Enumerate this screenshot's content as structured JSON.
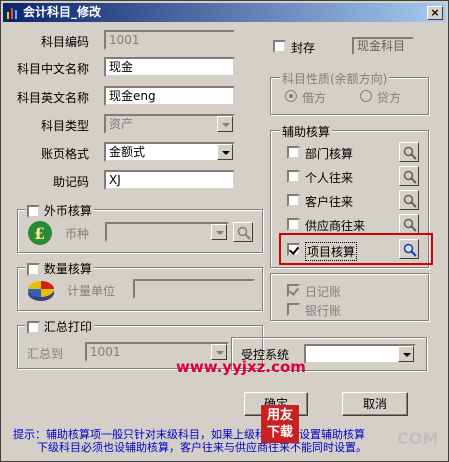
{
  "window": {
    "title": "会计科目_修改",
    "close_glyph": "×"
  },
  "form": {
    "code_label": "科目编码",
    "code_value": "1001",
    "cn_name_label": "科目中文名称",
    "cn_name_value": "现金",
    "en_name_label": "科目英文名称",
    "en_name_value": "现金eng",
    "type_label": "科目类型",
    "type_value": "资产",
    "format_label": "账页格式",
    "format_value": "金额式",
    "mnemonic_label": "助记码",
    "mnemonic_value": "XJ"
  },
  "seal": {
    "label": "封存",
    "checked": false,
    "badge": "现金科目"
  },
  "nature": {
    "title": "科目性质(余额方向)",
    "debit": "借方",
    "credit": "贷方",
    "selected": "debit"
  },
  "aux": {
    "title": "辅助核算",
    "items": [
      {
        "label": "部门核算",
        "checked": false
      },
      {
        "label": "个人往来",
        "checked": false
      },
      {
        "label": "客户往来",
        "checked": false
      },
      {
        "label": "供应商往来",
        "checked": false
      },
      {
        "label": "项目核算",
        "checked": true
      }
    ]
  },
  "books": {
    "journal": "日记账",
    "bank": "银行账",
    "journal_checked": true
  },
  "foreign": {
    "title": "外币核算",
    "currency_label": "币种",
    "currency_value": ""
  },
  "quantity": {
    "title": "数量核算",
    "unit_label": "计量单位",
    "unit_value": ""
  },
  "summary": {
    "title": "汇总打印",
    "to_label": "汇总到",
    "to_value": "1001"
  },
  "controlled": {
    "label": "受控系统",
    "value": ""
  },
  "buttons": {
    "ok": "确定",
    "cancel": "取消"
  },
  "hint": {
    "line1": "提示：辅助核算项一般只针对末级科目，如果上级科目也可设置辅助核算",
    "line2": "下级科目必须也设辅助核算，客户往来与供应商往来不能同时设置。"
  },
  "watermark": {
    "site": "www.yyjxz.com",
    "logo_top": "用友",
    "logo_bottom": "下载",
    "corner": "COM"
  },
  "colors": {
    "title_start": "#0a246a",
    "title_end": "#a6caf0",
    "hint": "#0000cc",
    "highlight": "#d40000"
  }
}
